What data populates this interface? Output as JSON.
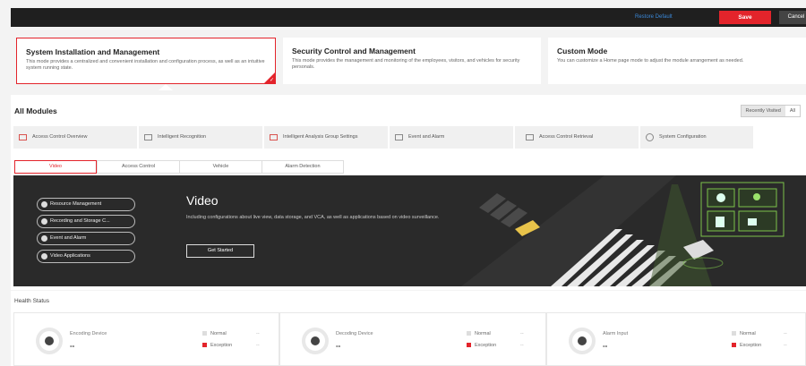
{
  "topbar": {
    "restore_label": "Restore Default",
    "save_label": "Save",
    "cancel_label": "Cancel"
  },
  "modes": [
    {
      "title": "System Installation and Management",
      "desc": "This mode provides a centralized and convenient installation and configuration process, as well as an intuitive system running state.",
      "selected": true
    },
    {
      "title": "Security Control and Management",
      "desc": "This mode provides the management and monitoring of the employees, visitors, and vehicles for security personals.",
      "selected": false
    },
    {
      "title": "Custom Mode",
      "desc": "You can customize a Home page mode to adjust the module arrangement as needed.",
      "selected": false
    }
  ],
  "all_modules": {
    "title": "All Modules",
    "filter": [
      "Recently Visited",
      "All"
    ],
    "modules": [
      {
        "label": "Access Control Overview",
        "icon": "access-control-icon"
      },
      {
        "label": "Intelligent Recognition",
        "icon": "recognition-icon"
      },
      {
        "label": "Intelligent Analysis Group Settings",
        "icon": "analysis-icon"
      },
      {
        "label": "Event and Alarm",
        "icon": "alarm-icon"
      },
      {
        "label": "Access Control Retrieval",
        "icon": "retrieval-icon"
      },
      {
        "label": "System Configuration",
        "icon": "gear-icon"
      }
    ],
    "tabs": [
      "Video",
      "Access Control",
      "Vehicle",
      "Alarm Detection"
    ]
  },
  "hero": {
    "steps": [
      "Resource Management",
      "Recording and Storage C...",
      "Event and Alarm",
      "Video Applications"
    ],
    "title": "Video",
    "desc": "Including configurations about live view, data storage, and VCA, as well as applications based on video surveillance.",
    "button_label": "Get Started"
  },
  "health": {
    "title": "Health Status",
    "cards": [
      {
        "name": "Encoding Device",
        "value": "--",
        "normal_label": "Normal",
        "normal_value": "--",
        "exception_label": "Exception",
        "exception_value": "--"
      },
      {
        "name": "Decoding Device",
        "value": "--",
        "normal_label": "Normal",
        "normal_value": "--",
        "exception_label": "Exception",
        "exception_value": "--"
      },
      {
        "name": "Alarm Input",
        "value": "--",
        "normal_label": "Normal",
        "normal_value": "--",
        "exception_label": "Exception",
        "exception_value": "--"
      }
    ]
  },
  "colors": {
    "accent": "#e3242b",
    "link": "#3b88d8",
    "topbar": "#1f1f1f"
  }
}
